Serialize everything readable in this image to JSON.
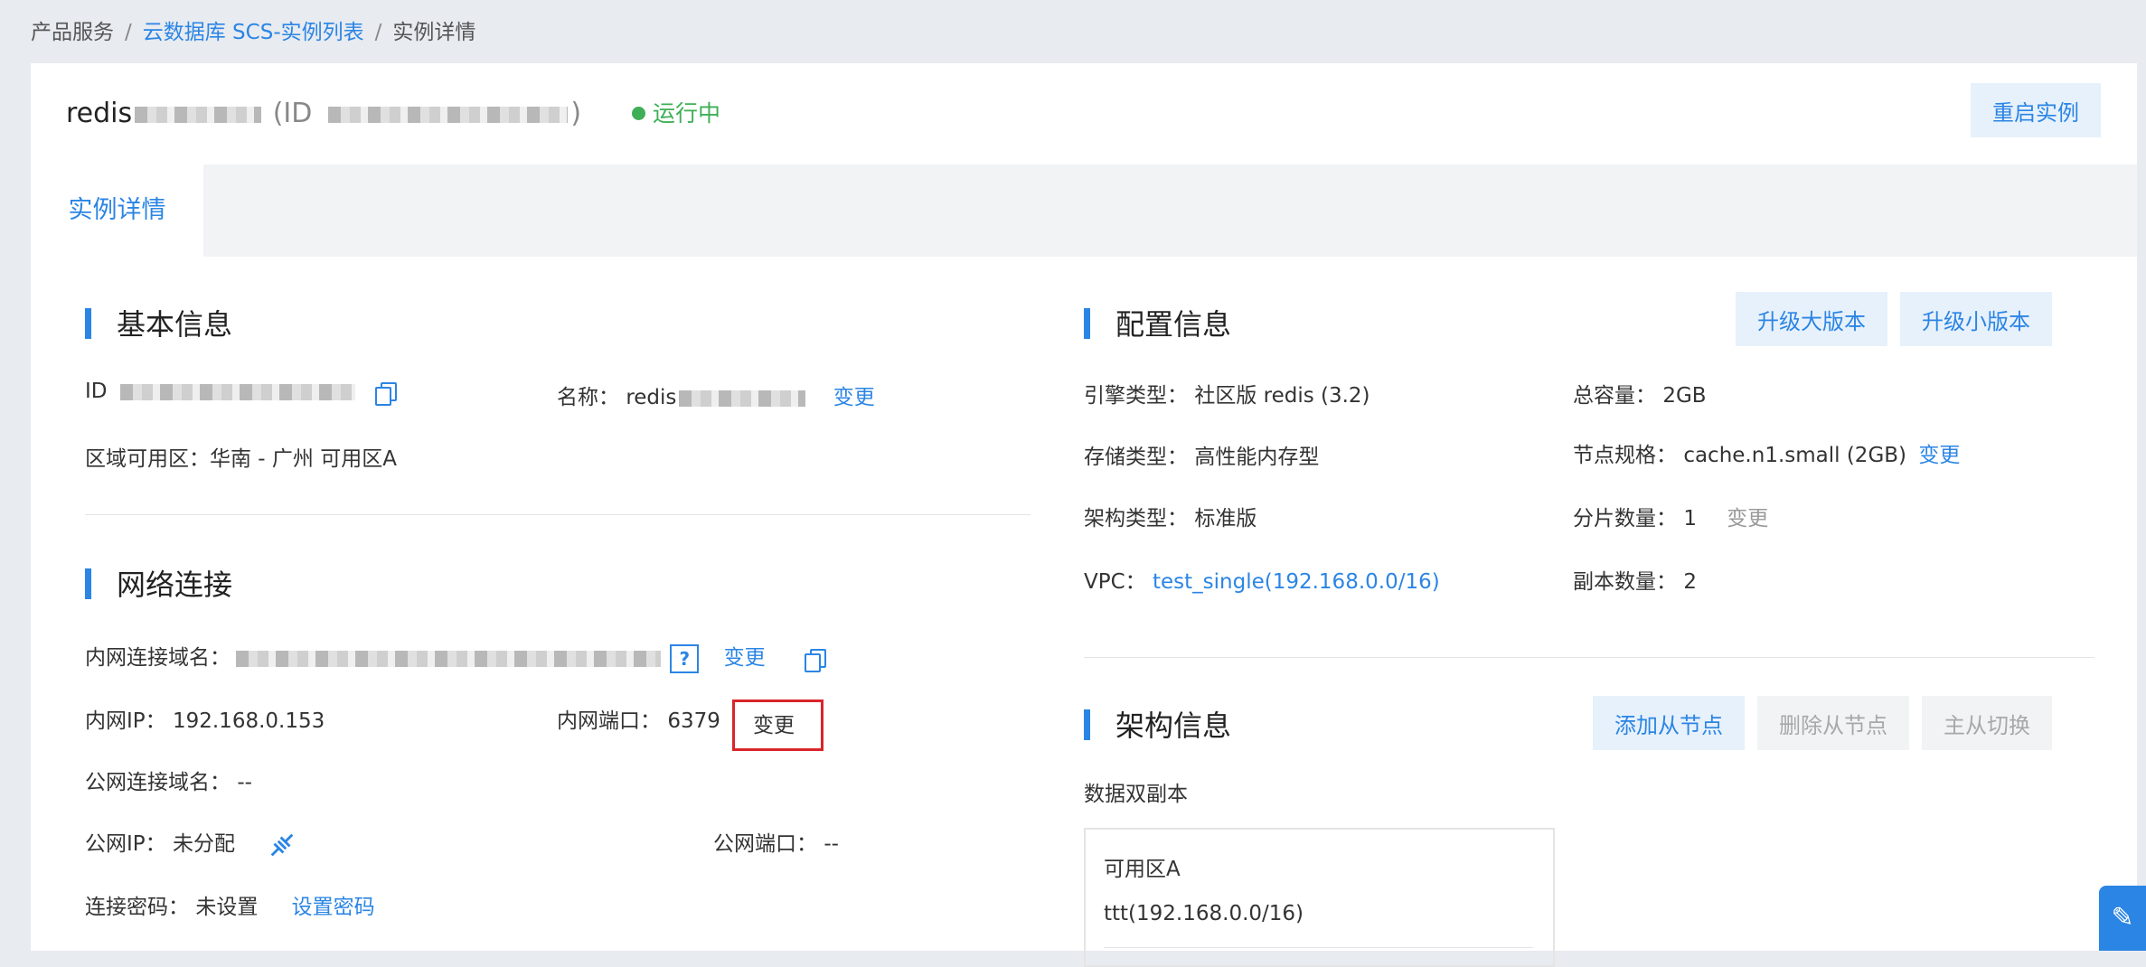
{
  "breadcrumb": {
    "item1": "产品服务",
    "item2": "云数据库 SCS-实例列表",
    "item3": "实例详情",
    "sep": "/"
  },
  "header": {
    "name_prefix": "redis",
    "id_prefix": "(ID",
    "id_suffix": ")",
    "status": "运行中",
    "restart_button": "重启实例"
  },
  "tabs": {
    "active": "实例详情"
  },
  "basic": {
    "title": "基本信息",
    "id_label": "ID",
    "name_label": "名称：",
    "name_value": "redis",
    "name_change": "变更",
    "zone_label": "区域可用区：",
    "zone_value": "华南 - 广州 可用区A"
  },
  "network": {
    "title": "网络连接",
    "domain_label": "内网连接域名：",
    "help_glyph": "?",
    "domain_change": "变更",
    "ip_label": "内网IP：",
    "ip_value": "192.168.0.153",
    "port_label": "内网端口：",
    "port_value": "6379",
    "port_change": "变更",
    "public_domain_label": "公网连接域名：",
    "public_domain_value": "--",
    "public_ip_label": "公网IP：",
    "public_ip_value": "未分配",
    "public_port_label": "公网端口：",
    "public_port_value": "--",
    "password_label": "连接密码：",
    "password_value": "未设置",
    "password_link": "设置密码"
  },
  "config": {
    "title": "配置信息",
    "upgrade_major": "升级大版本",
    "upgrade_minor": "升级小版本",
    "engine_label": "引擎类型：",
    "engine_value": "社区版 redis (3.2)",
    "capacity_label": "总容量：",
    "capacity_value": "2GB",
    "storage_label": "存储类型：",
    "storage_value": "高性能内存型",
    "spec_label": "节点规格：",
    "spec_value": "cache.n1.small (2GB)",
    "spec_change": "变更",
    "arch_label": "架构类型：",
    "arch_value": "标准版",
    "shard_label": "分片数量：",
    "shard_value": "1",
    "shard_change": "变更",
    "vpc_label": "VPC：",
    "vpc_value": "test_single(192.168.0.0/16)",
    "replica_label": "副本数量：",
    "replica_value": "2"
  },
  "architecture": {
    "title": "架构信息",
    "add_node": "添加从节点",
    "delete_node": "删除从节点",
    "switch": "主从切换",
    "mode": "数据双副本",
    "zone_name": "可用区A",
    "zone_vpc": "ttt(192.168.0.0/16)"
  },
  "colors": {
    "accent": "#2b85e4",
    "success": "#3eaf56",
    "highlight": "#d9252a"
  },
  "icons": {
    "copy": "copy-icon",
    "help": "help-icon",
    "bind": "bind-ip-icon",
    "edit": "edit-icon"
  }
}
